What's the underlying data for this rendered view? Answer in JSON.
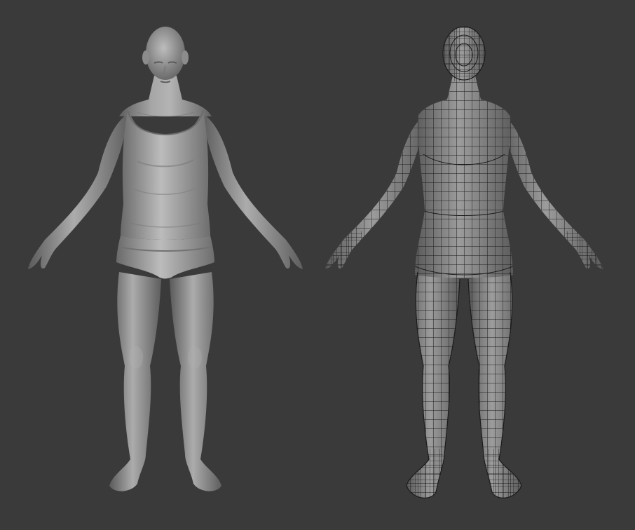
{
  "scene": {
    "background_color": "#3a3a3a",
    "models": [
      {
        "name": "sculpt-model",
        "render_mode": "shaded",
        "clothing": [
          "tank-top",
          "briefs"
        ],
        "surface_color": "#8e8e8e",
        "highlight_color": "#b9b9b9",
        "shadow_color": "#555555"
      },
      {
        "name": "wireframe-model",
        "render_mode": "wireframe",
        "surface_color": "#8a8a8a",
        "wire_color": "#1a1a1a"
      }
    ]
  }
}
